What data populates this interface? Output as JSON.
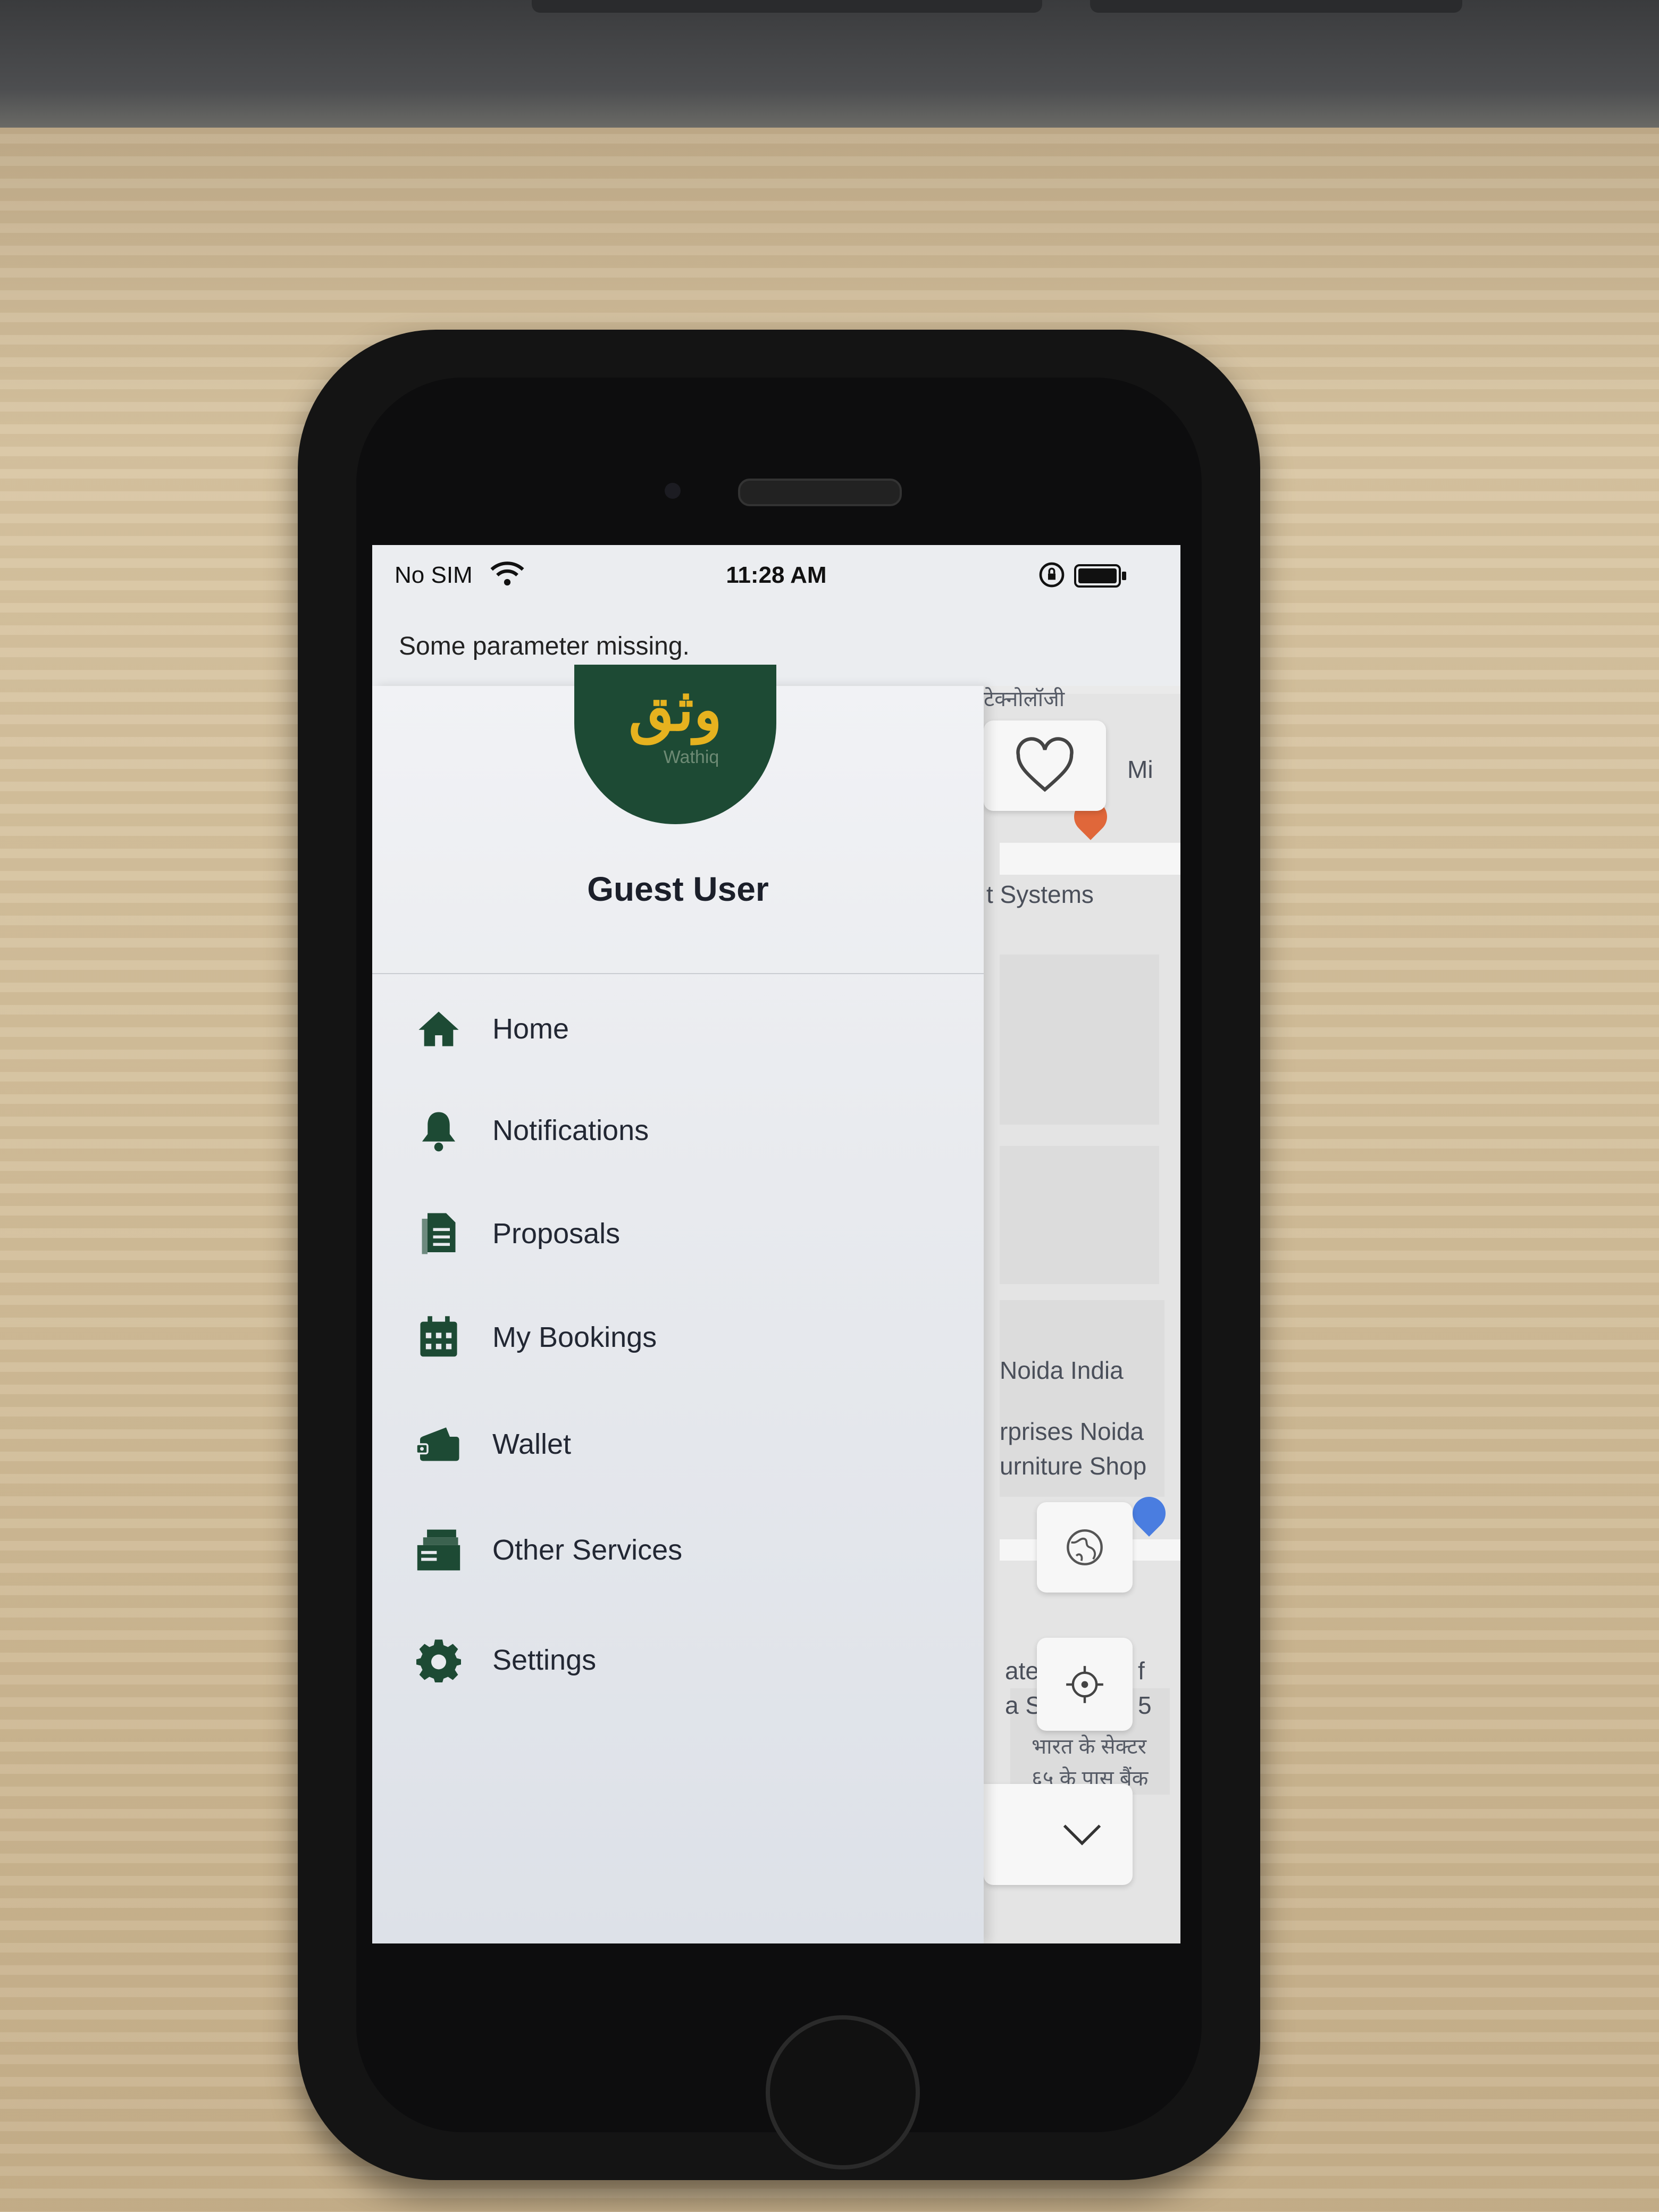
{
  "status_bar": {
    "carrier": "No SIM",
    "time": "11:28 AM"
  },
  "toast": {
    "message": "Some parameter missing."
  },
  "drawer": {
    "logo_text_ar": "وثق",
    "logo_text_en": "Wathiq",
    "user_name": "Guest User",
    "menu_items": [
      {
        "label": "Home",
        "icon": "home-icon"
      },
      {
        "label": "Notifications",
        "icon": "bell-icon"
      },
      {
        "label": "Proposals",
        "icon": "document-icon"
      },
      {
        "label": "My Bookings",
        "icon": "calendar-icon"
      },
      {
        "label": "Wallet",
        "icon": "wallet-icon"
      },
      {
        "label": "Other Services",
        "icon": "services-icon"
      },
      {
        "label": "Settings",
        "icon": "gear-icon"
      }
    ]
  },
  "map": {
    "labels": {
      "top_hindi": "टेक्नोलॉजी",
      "mi": "Mi",
      "systems": "t Systems",
      "noida_india": "Noida India",
      "enterprises_noida": "rprises Noida",
      "furniture_shop": "urniture Shop",
      "ate": "ate",
      "as": "a S",
      "f": "f",
      "five": "5",
      "hindi_sector": "भारत के सेक्टर",
      "hindi_sector_2": "६५ के पास बैंक"
    }
  },
  "colors": {
    "drawer_icon": "#1d4a34",
    "avatar_bg": "#1d4a34",
    "logo_gold": "#e6b21f",
    "map_pin_red": "#e0673a",
    "map_pin_blue": "#4a7de0"
  }
}
